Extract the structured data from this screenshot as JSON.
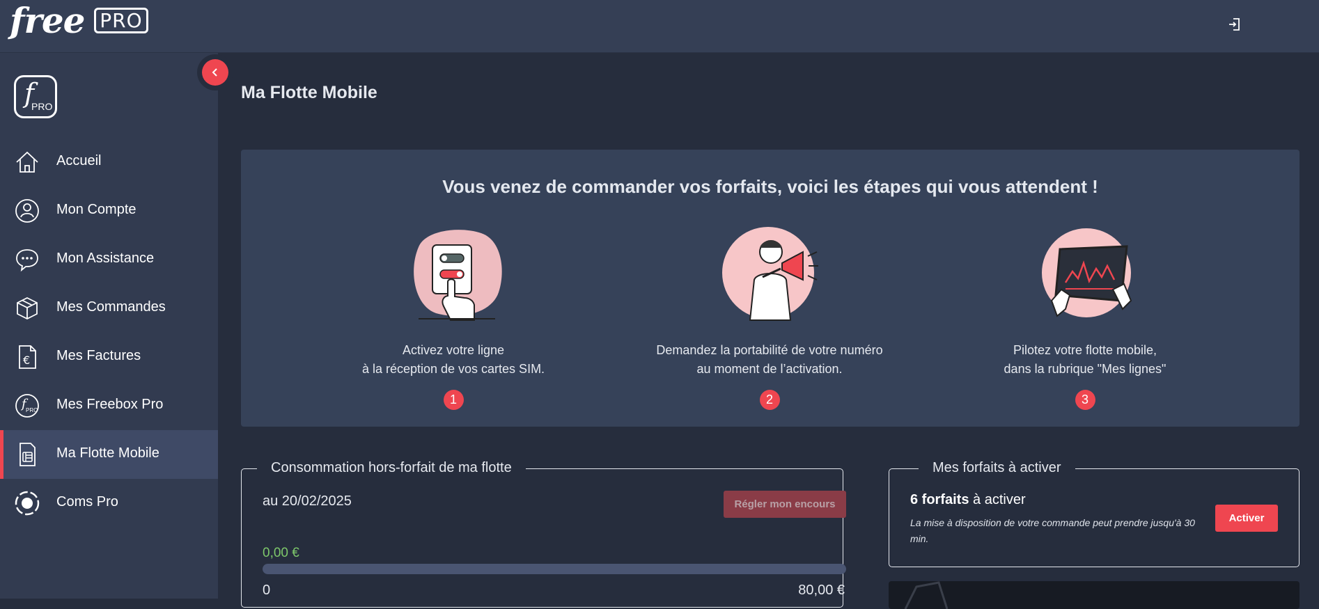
{
  "header": {
    "logo_text": "free",
    "logo_badge": "PRO",
    "logout_icon": "logout-icon"
  },
  "sidebar": {
    "brand_badge": "PRO",
    "collapse_icon": "chevron-left-icon",
    "items": [
      {
        "label": "Accueil",
        "icon": "home-icon",
        "active": false
      },
      {
        "label": "Mon Compte",
        "icon": "user-icon",
        "active": false
      },
      {
        "label": "Mon Assistance",
        "icon": "chat-icon",
        "active": false
      },
      {
        "label": "Mes Commandes",
        "icon": "package-icon",
        "active": false
      },
      {
        "label": "Mes Factures",
        "icon": "invoice-icon",
        "active": false
      },
      {
        "label": "Mes Freebox Pro",
        "icon": "freebox-icon",
        "active": false
      },
      {
        "label": "Ma Flotte Mobile",
        "icon": "sim-card-icon",
        "active": true
      },
      {
        "label": "Coms Pro",
        "icon": "coms-icon",
        "active": false
      }
    ]
  },
  "main": {
    "page_title": "Ma Flotte Mobile",
    "steps": {
      "headline": "Vous venez de commander vos forfaits, voici les étapes qui vous attendent !",
      "items": [
        {
          "line1": "Activez votre ligne",
          "line2": "à la réception de vos cartes SIM.",
          "number": "1"
        },
        {
          "line1": "Demandez la portabilité de votre numéro",
          "line2": "au moment de l’activation.",
          "number": "2"
        },
        {
          "line1": "Pilotez votre flotte mobile,",
          "line2": "dans la rubrique \"Mes lignes\"",
          "number": "3"
        }
      ]
    },
    "consumption": {
      "legend": "Consommation hors-forfait de ma flotte",
      "date": "au 20/02/2025",
      "button": "Régler mon encours",
      "amount": "0,00 €",
      "progress_fraction": 0,
      "min_label": "0",
      "max_label": "80,00 €"
    },
    "plans": {
      "legend": "Mes forfaits à activer",
      "count_bold": "6 forfaits",
      "count_rest": " à activer",
      "note": "La mise à disposition de votre commande peut prendre jusqu'à 30 min.",
      "button": "Activer"
    }
  },
  "colors": {
    "accent": "#ef4650",
    "sidebar_bg": "#323b50",
    "page_bg": "#262d3d",
    "card_bg": "#364259",
    "success": "#7ec86b"
  }
}
